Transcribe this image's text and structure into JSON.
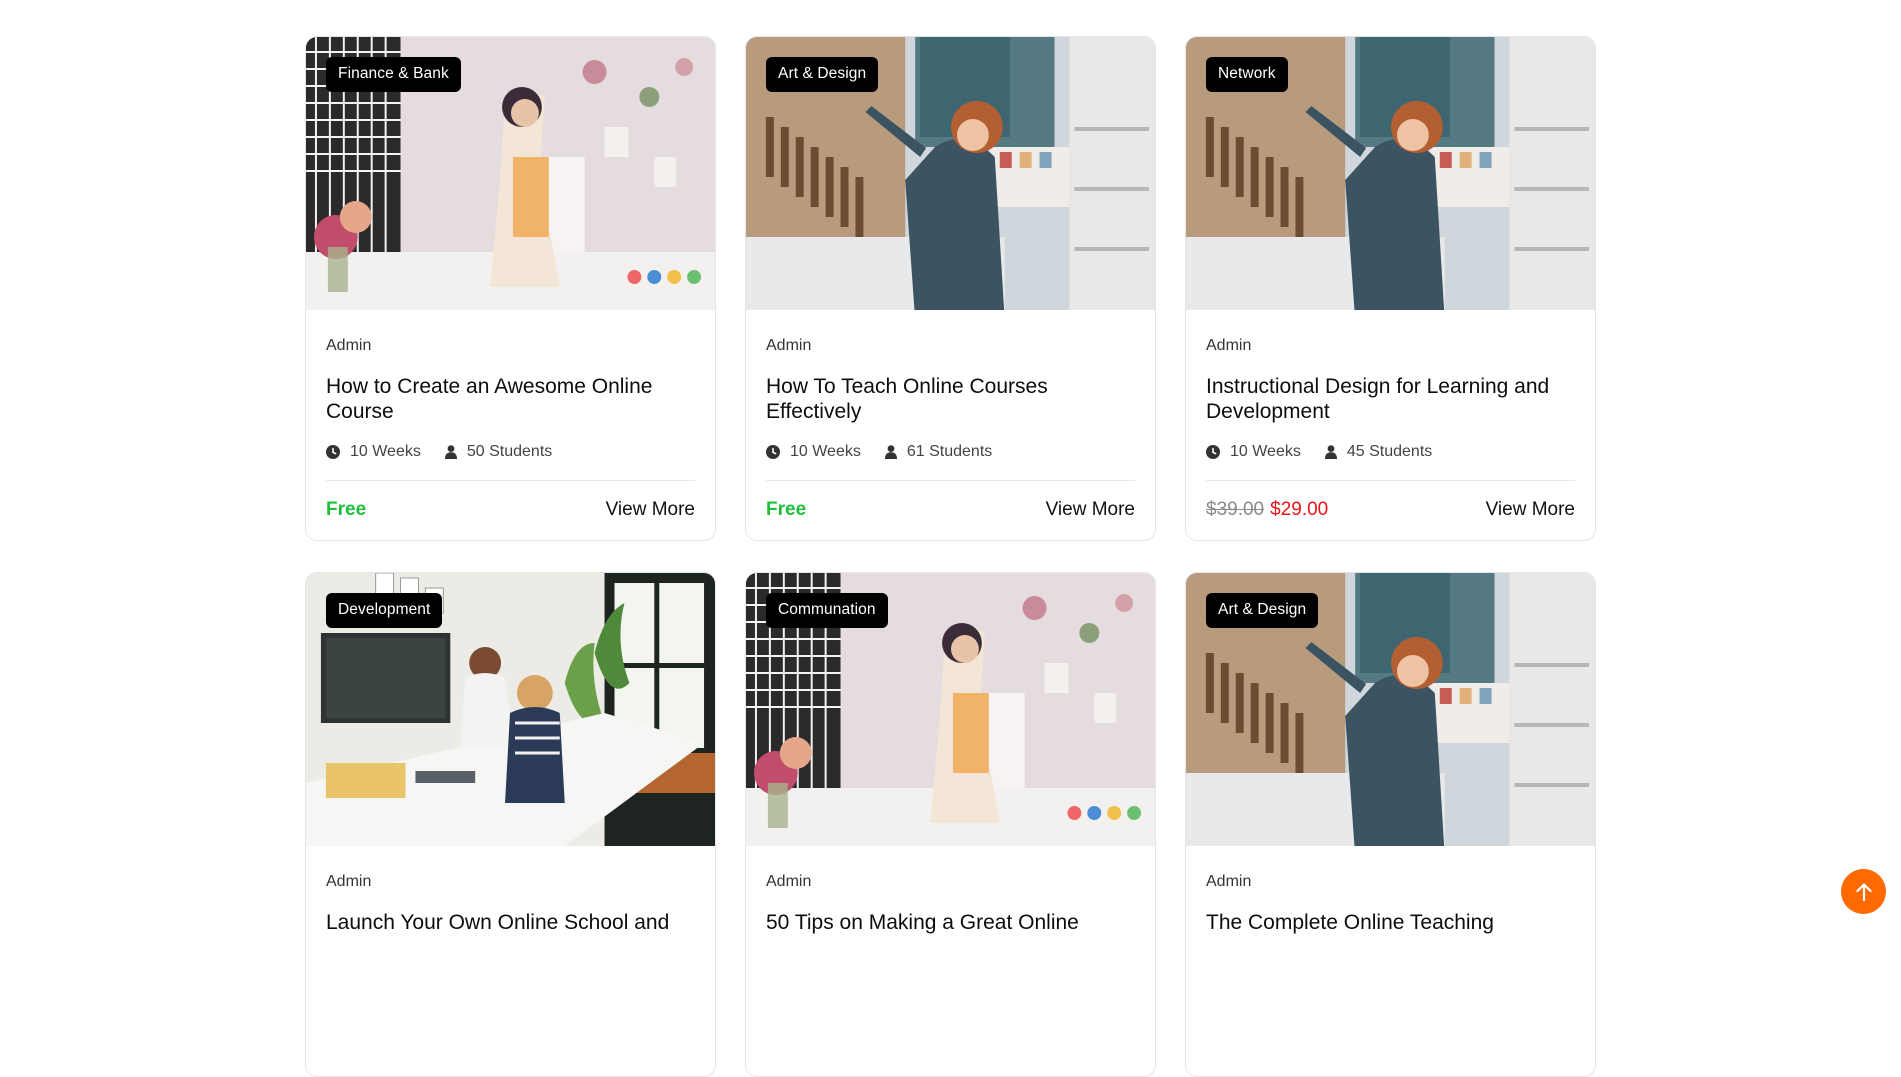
{
  "cards": [
    {
      "category": "Finance & Bank",
      "author": "Admin",
      "title": "How to Create an Awesome Online Course",
      "duration": "10 Weeks",
      "students": "50 Students",
      "price_free": "Free",
      "view_more": "View More",
      "image": "woman-painting-studio-photo"
    },
    {
      "category": "Art & Design",
      "author": "Admin",
      "title": "How To Teach Online Courses Effectively",
      "duration": "10 Weeks",
      "students": "61 Students",
      "price_free": "Free",
      "view_more": "View More",
      "image": "woman-art-studio-photo"
    },
    {
      "category": "Network",
      "author": "Admin",
      "title": "Instructional Design for Learning and Development",
      "duration": "10 Weeks",
      "students": "45 Students",
      "price_old": "$39.00",
      "price_new": "$29.00",
      "view_more": "View More",
      "image": "woman-art-studio-photo"
    },
    {
      "category": "Development",
      "author": "Admin",
      "title": "Launch Your Own Online School and",
      "image": "two-women-workshop-photo"
    },
    {
      "category": "Communation",
      "author": "Admin",
      "title": "50 Tips on Making a Great Online",
      "image": "woman-painting-studio-photo"
    },
    {
      "category": "Art & Design",
      "author": "Admin",
      "title": "The Complete Online Teaching",
      "image": "woman-art-studio-photo"
    }
  ],
  "colors": {
    "free": "#1fbf3c",
    "sale": "#e8141b",
    "accent": "#ff6a00"
  },
  "icons": {
    "clock": "clock-icon",
    "user": "user-icon",
    "scroll_top": "arrow-up-icon"
  }
}
